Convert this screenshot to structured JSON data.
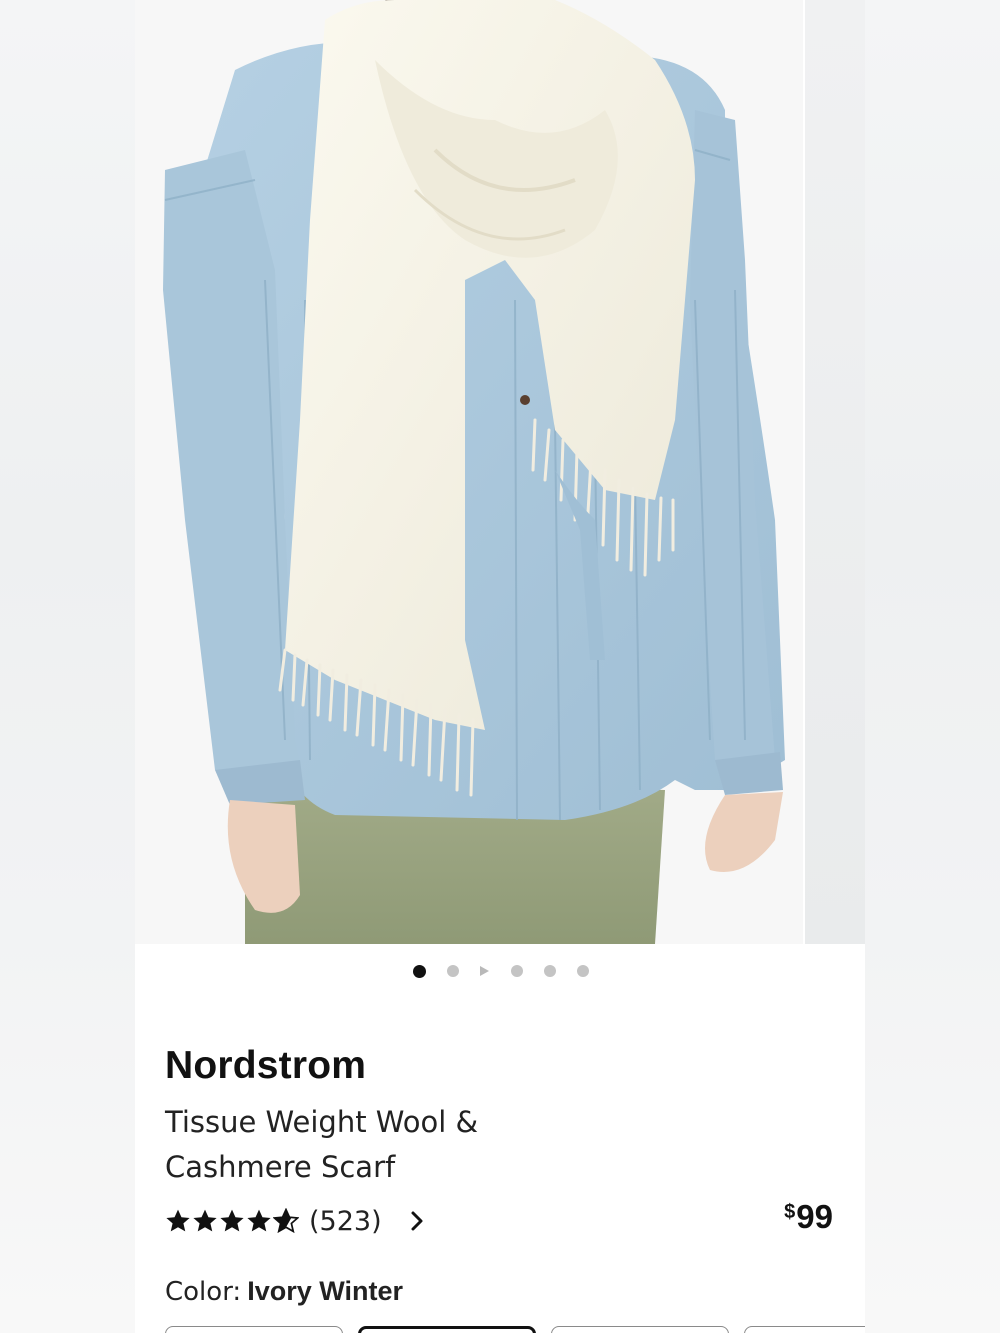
{
  "product": {
    "brand": "Nordstrom",
    "title": "Tissue Weight Wool & Cashmere Scarf",
    "rating": 4.5,
    "review_count": "(523)",
    "price_currency": "$",
    "price_amount": "99",
    "color_label": "Color:",
    "color_value": "Ivory Winter"
  },
  "carousel": {
    "total_images": 6,
    "active_index": 0,
    "has_video": true
  },
  "icons": {
    "star": "star-icon",
    "chevron": "chevron-right-icon",
    "play": "play-icon"
  },
  "colors": {
    "accent": "#111111",
    "dot_inactive": "#c4c4c4",
    "jacket": "#a9c7dc",
    "scarf": "#f6f3e6",
    "pants": "#97a27f"
  }
}
